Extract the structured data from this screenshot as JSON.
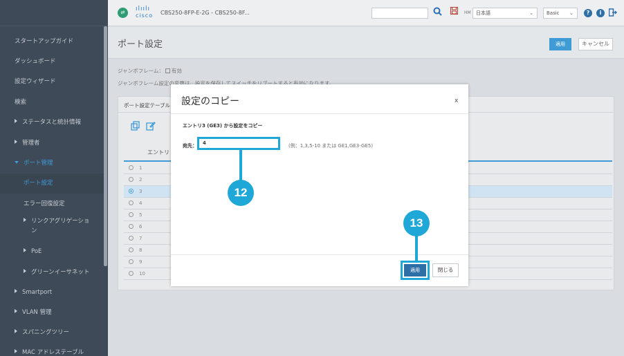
{
  "sidebar": {
    "items": [
      {
        "label": "スタートアップガイド"
      },
      {
        "label": "ダッシュボード"
      },
      {
        "label": "設定ウィザード"
      },
      {
        "label": "検索"
      },
      {
        "label": "ステータスと統計情報"
      },
      {
        "label": "管理者"
      },
      {
        "label": "ポート管理"
      },
      {
        "label": "ポート設定"
      },
      {
        "label": "エラー回復設定"
      },
      {
        "label": "リンクアグリゲーショ"
      },
      {
        "label": "ン"
      },
      {
        "label": "PoE"
      },
      {
        "label": "グリーンイーサネット"
      },
      {
        "label": "Smartport"
      },
      {
        "label": "VLAN 管理"
      },
      {
        "label": "スパニングツリー"
      },
      {
        "label": "MAC アドレステーブル"
      }
    ]
  },
  "header": {
    "logo_text": "cisco",
    "device_name": "CBS250-8FP-E-2G - CBS250-8F...",
    "hm": "HM",
    "language": "日本語",
    "mode": "Basic"
  },
  "page": {
    "title": "ポート設定",
    "apply": "適用",
    "cancel": "キャンセル",
    "jumbo_label": "ジャンボフレーム：",
    "jumbo_value": "有効",
    "jumbo_note": "ジャンボフレーム設定の変更は、設定を保存してスイッチをリブートすると有効になります。",
    "table_title": "ポート設定テーブル",
    "entry_header": "エントリ",
    "rows": [
      "1",
      "2",
      "3",
      "4",
      "5",
      "6",
      "7",
      "8",
      "9",
      "10"
    ],
    "selected_row": "3"
  },
  "modal": {
    "title": "設定のコピー",
    "close": "x",
    "description": "エントリ3 (GE3) から設定をコピー",
    "dest_label": "宛先：",
    "dest_value": "4",
    "dest_hint": "(例：1,3,5-10 または GE1,GE3-GE5)",
    "apply": "適用",
    "close_button": "閉じる"
  },
  "callouts": {
    "dest_step": "12",
    "apply_step": "13"
  },
  "colors": {
    "sidebar_bg": "#3e4a57",
    "accent": "#3e9bd6",
    "callout": "#1ea7d7"
  }
}
